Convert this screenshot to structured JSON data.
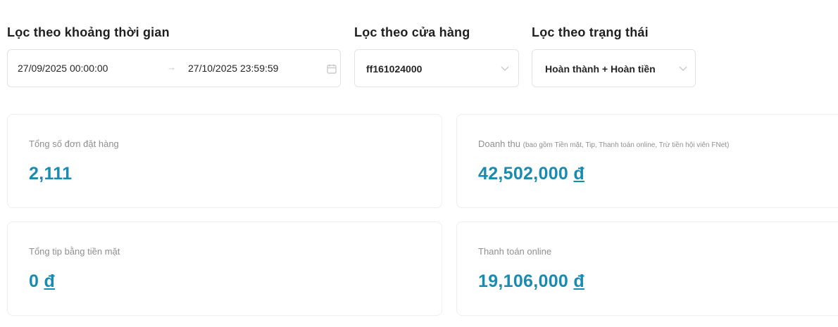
{
  "filters": {
    "time": {
      "label": "Lọc theo khoảng thời gian",
      "start": "27/09/2025 00:00:00",
      "separator": "→",
      "end": "27/10/2025 23:59:59",
      "icon": "calendar-icon"
    },
    "store": {
      "label": "Lọc theo cửa hàng",
      "value": "ff161024000",
      "icon": "chevron-down-icon"
    },
    "status": {
      "label": "Lọc theo trạng thái",
      "value": "Hoàn thành + Hoàn tiền",
      "icon": "chevron-down-icon"
    }
  },
  "cards": {
    "orders": {
      "label": "Tổng số đơn đặt hàng",
      "value": "2,111"
    },
    "revenue": {
      "label": "Doanh thu",
      "note": "(bao gồm Tiền mặt, Tip, Thanh toán online, Trừ tiền hội viên FNet)",
      "value": "42,502,000",
      "currency": "đ"
    },
    "tip": {
      "label": "Tổng tip bằng tiền mặt",
      "value": "0",
      "currency": "đ"
    },
    "online": {
      "label": "Thanh toán online",
      "value": "19,106,000",
      "currency": "đ"
    }
  },
  "colors": {
    "accent": "#1a8bb0",
    "muted_text": "#8f8f8f",
    "border": "#e1e3e6"
  }
}
